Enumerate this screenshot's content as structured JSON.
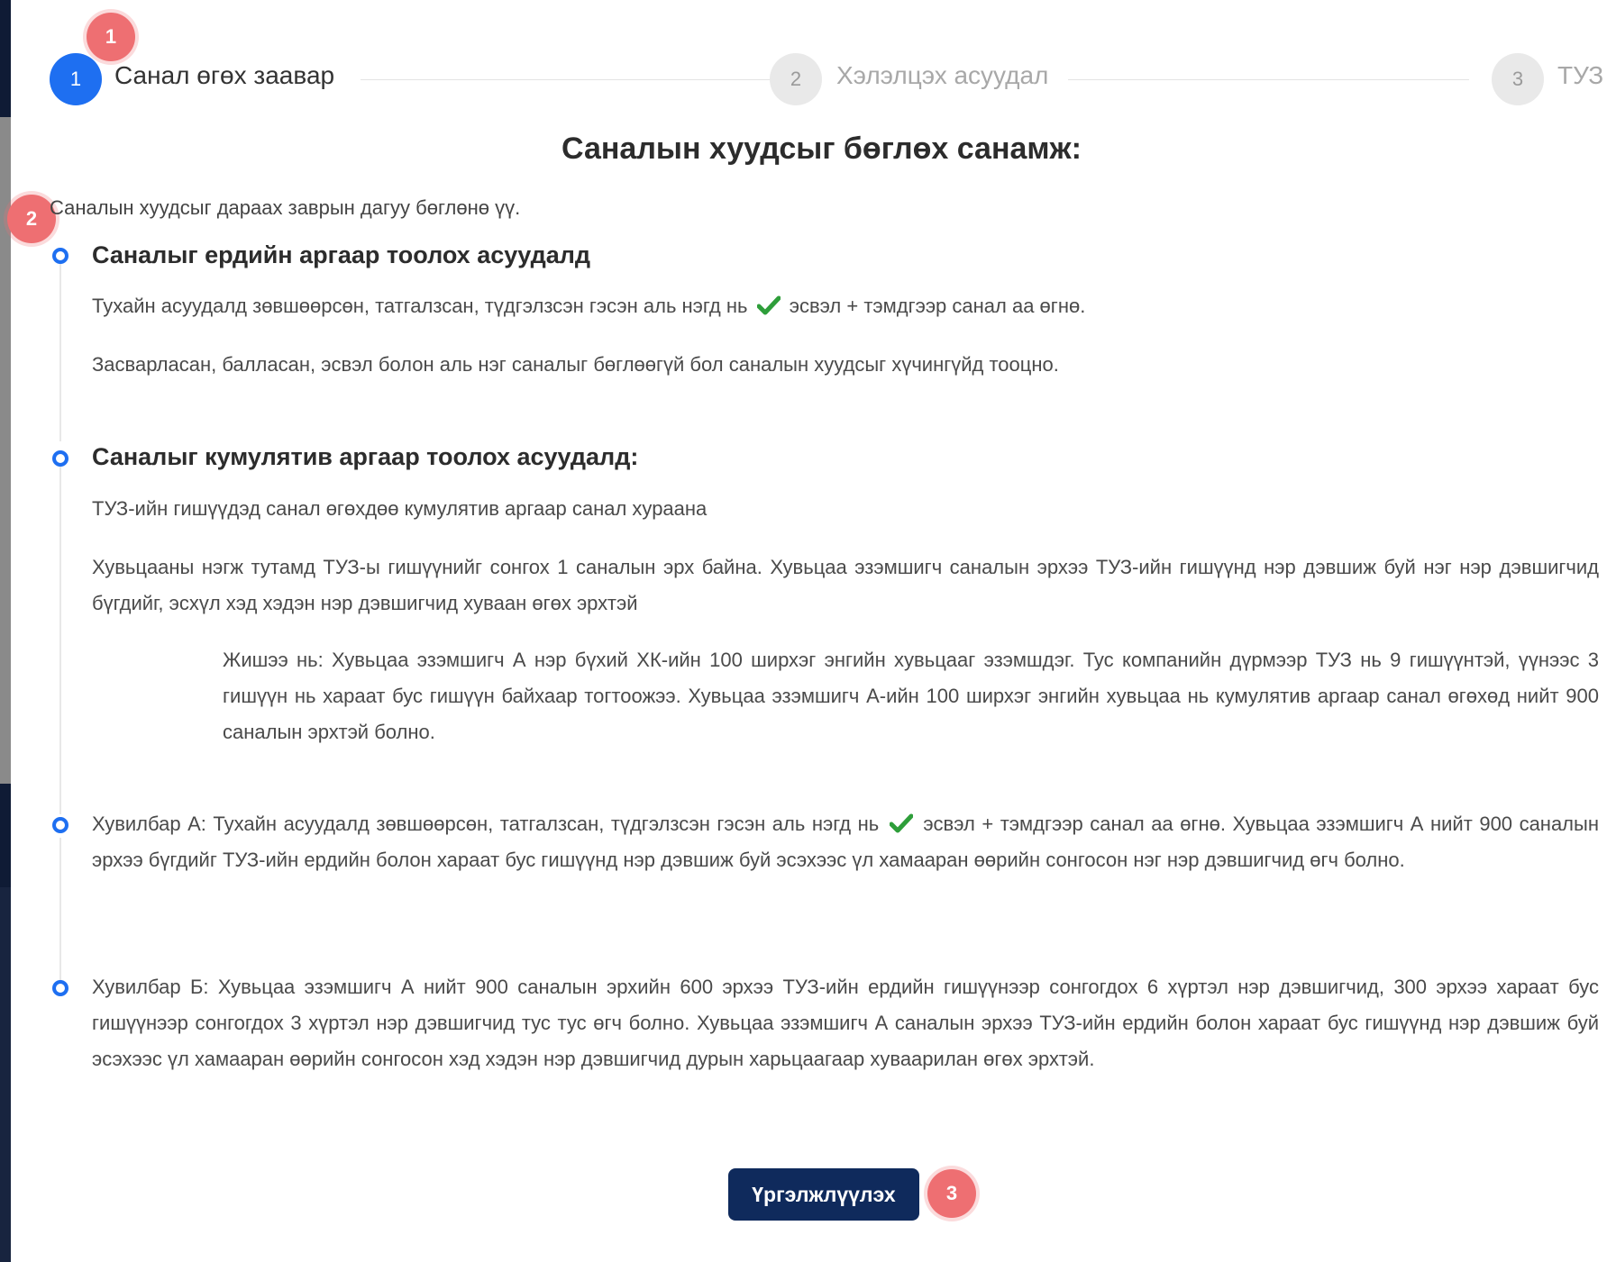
{
  "stepper": {
    "steps": [
      {
        "number": "1",
        "label": "Санал өгөх заавар",
        "active": true
      },
      {
        "number": "2",
        "label": "Хэлэлцэх асуудал",
        "active": false
      },
      {
        "number": "3",
        "label": "ТУЗ",
        "active": false
      }
    ]
  },
  "markers": [
    "1",
    "2",
    "3"
  ],
  "page_title": "Саналын хуудсыг бөглөх санамж:",
  "intro": "Саналын хуудсыг дараах заврын дагуу бөглөнө үү.",
  "section1": {
    "heading": "Саналыг ердийн аргаар тоолох асуудалд",
    "p1_before": "Тухайн асуудалд зөвшөөрсөн, татгалзсан, түдгэлзсэн гэсэн аль нэгд нь",
    "p1_after": "эсвэл + тэмдгээр санал аа өгнө.",
    "p2": "Засварласан, балласан, эсвэл болон аль нэг саналыг бөглөөгүй бол саналын хуудсыг хүчингүйд тооцно."
  },
  "section2": {
    "heading": "Саналыг кумулятив аргаар тоолох асуудалд:",
    "p1": "ТУЗ-ийн гишүүдэд санал өгөхдөө кумулятив аргаар санал хураана",
    "p2": "Хувьцааны нэгж тутамд ТУЗ-ы гишүүнийг сонгох 1 саналын эрх байна. Хувьцаа эзэмшигч саналын эрхээ ТУЗ-ийн гишүүнд нэр дэвшиж буй нэг нэр дэвшигчид бүгдийг, эсхүл хэд хэдэн нэр дэвшигчид хуваан өгөх эрхтэй",
    "example": "Жишээ нь: Хувьцаа эзэмшигч А нэр бүхий ХК-ийн 100 ширхэг энгийн хувьцааг эзэмшдэг. Тус компанийн дүрмээр ТУЗ нь 9 гишүүнтэй, үүнээс 3 гишүүн нь хараат бус гишүүн байхаар тогтоожээ. Хувьцаа эзэмшигч А-ийн 100 ширхэг энгийн хувьцаа нь кумулятив аргаар санал өгөхөд нийт 900 саналын эрхтэй болно."
  },
  "option_a": {
    "before": "Хувилбар А: Тухайн асуудалд зөвшөөрсөн, татгалзсан, түдгэлзсэн гэсэн аль нэгд нь",
    "after": "эсвэл + тэмдгээр санал аа өгнө. Хувьцаа эзэмшигч А нийт 900 саналын эрхээ бүгдийг ТУЗ-ийн ердийн болон хараат бус гишүүнд нэр дэвшиж буй эсэхээс үл хамааран өөрийн сонгосон нэг нэр дэвшигчид өгч болно."
  },
  "option_b": "Хувилбар Б: Хувьцаа эзэмшигч А нийт 900 саналын эрхийн 600 эрхээ ТУЗ-ийн ердийн гишүүнээр сонгогдох 6 хүртэл нэр дэвшигчид, 300 эрхээ хараат бус гишүүнээр сонгогдох 3 хүртэл нэр дэвшигчид тус тус өгч болно. Хувьцаа эзэмшигч А саналын эрхээ ТУЗ-ийн ердийн болон хараат бус гишүүнд нэр дэвшиж буй эсэхээс үл хамааран өөрийн сонгосон хэд хэдэн нэр дэвшигчид дурын харьцаагаар хуваарилан өгөх эрхтэй.",
  "continue_label": "Үргэлжлүүлэх",
  "colors": {
    "primary": "#1e6ff1",
    "button": "#0f2a5c",
    "marker": "#ee6f72",
    "check": "#2e9e3a"
  }
}
